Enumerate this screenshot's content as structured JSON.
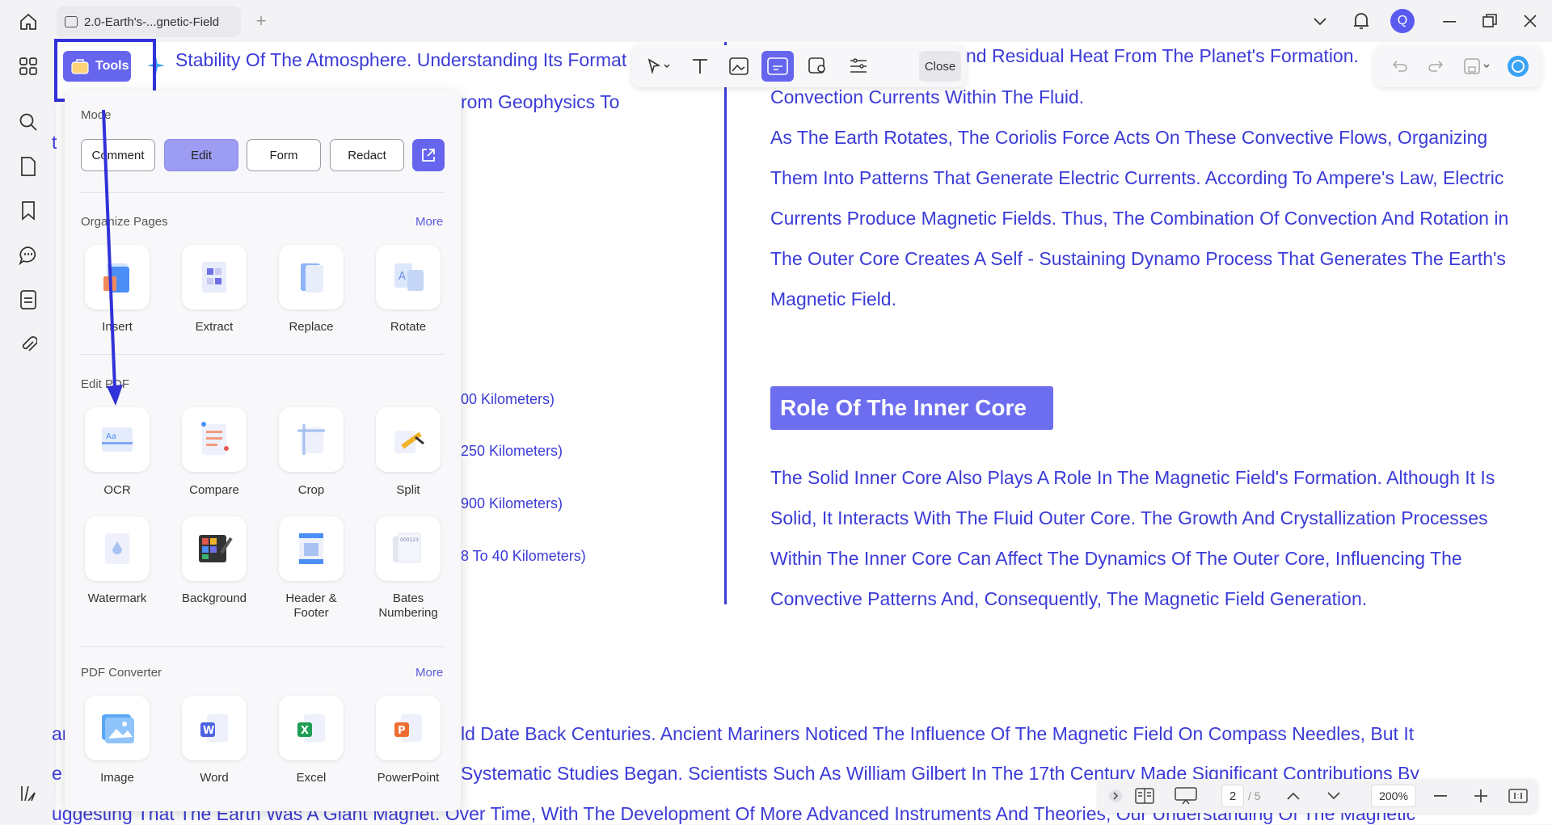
{
  "window": {
    "tab_title": "2.0-Earth's-...gnetic-Field",
    "new_tab_symbol": "+",
    "avatar_letter": "Q"
  },
  "toolbar": {
    "close_label": "Close"
  },
  "tools_button": {
    "label": "Tools"
  },
  "panel": {
    "mode_title": "Mode",
    "modes": [
      "Comment",
      "Edit",
      "Form",
      "Redact"
    ],
    "active_mode": "Edit",
    "organize_title": "Organize Pages",
    "organize_more": "More",
    "organize_items": [
      "Insert",
      "Extract",
      "Replace",
      "Rotate"
    ],
    "edit_title": "Edit PDF",
    "edit_items": [
      "OCR",
      "Compare",
      "Crop",
      "Split"
    ],
    "edit_items_2": [
      "Watermark",
      "Background",
      "Header & Footer",
      "Bates Numbering"
    ],
    "converter_title": "PDF Converter",
    "converter_more": "More",
    "converter_items": [
      "Image",
      "Word",
      "Excel",
      "PowerPoint"
    ]
  },
  "document": {
    "left_top_1": "Stability Of The Atmosphere. Understanding Its Format",
    "left_top_2": "rom Geophysics To",
    "left_layers": [
      "00 Kilometers)",
      "250 Kilometers)",
      "900 Kilometers)",
      "8 To 40 Kilometers)"
    ],
    "right_para_1": [
      "nd Residual Heat From The Planet's Formation.",
      "Convection Currents Within The Fluid.",
      "As The Earth Rotates, The Coriolis Force Acts On These Convective Flows, Organizing",
      "Them Into Patterns That Generate Electric Currents. According To Ampere's Law, Electric",
      "Currents Produce Magnetic Fields. Thus, The Combination Of Convection And Rotation in",
      "The Outer Core Creates A Self - Sustaining Dynamo Process That Generates The Earth's",
      "Magnetic Field."
    ],
    "heading": "Role Of The Inner Core",
    "right_para_2": [
      "The Solid Inner Core Also Plays A Role In The Magnetic Field's Formation. Although It Is",
      "Solid, It Interacts With The Fluid Outer Core. The Growth And Crystallization Processes",
      "Within The Inner Core Can Affect The Dynamics Of The Outer Core, Influencing The",
      "Convective Patterns And, Consequently, The Magnetic Field Generation."
    ],
    "bottom_lines": [
      "ld Date Back Centuries. Ancient Mariners Noticed The Influence Of The Magnetic Field On Compass Needles, But It",
      "Systematic Studies Began. Scientists Such As William Gilbert In The 17th Century Made Significant Contributions By",
      "uggesting That The Earth Was A Giant Magnet. Over Time, With The Development Of More Advanced Instruments And Theories, Our Understanding Of The Magnetic"
    ],
    "bottom_left_frag_1": "ar",
    "bottom_left_frag_2": "e",
    "left_edge_frag": "t"
  },
  "statusbar": {
    "page_current": "2",
    "page_total": "/ 5",
    "zoom": "200%"
  },
  "colors": {
    "accent": "#6565ee",
    "doc_text": "#3b3bd8",
    "highlight_box": "#3232d8"
  }
}
